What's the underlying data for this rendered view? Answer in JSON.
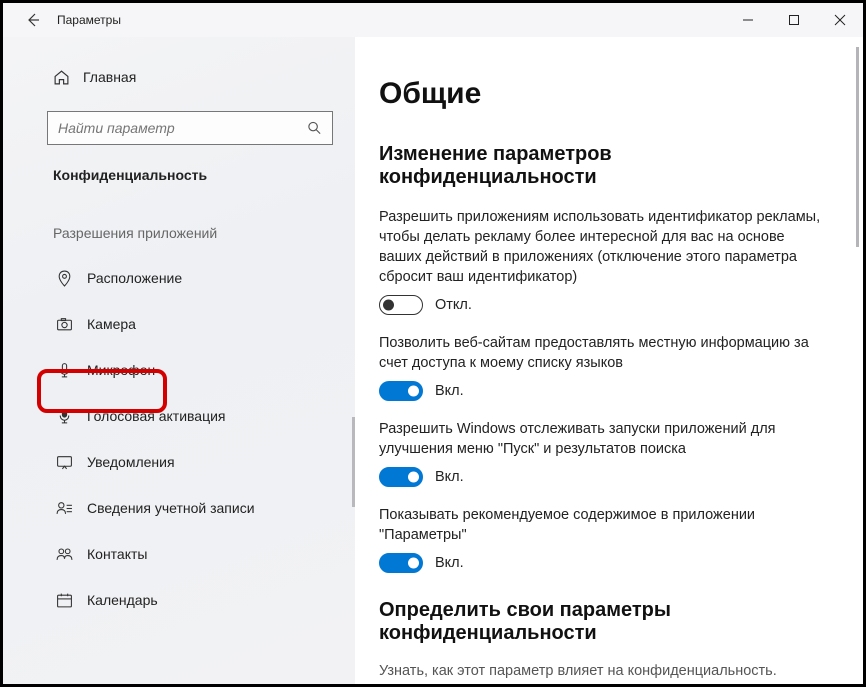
{
  "titlebar": {
    "title": "Параметры"
  },
  "sidebar": {
    "home": "Главная",
    "search_placeholder": "Найти параметр",
    "section": "Конфиденциальность",
    "group": "Разрешения приложений",
    "items": [
      {
        "icon": "location",
        "label": "Расположение"
      },
      {
        "icon": "camera",
        "label": "Камера"
      },
      {
        "icon": "microphone",
        "label": "Микрофон"
      },
      {
        "icon": "voice",
        "label": "Голосовая активация"
      },
      {
        "icon": "notifications",
        "label": "Уведомления"
      },
      {
        "icon": "account",
        "label": "Сведения учетной записи"
      },
      {
        "icon": "contacts",
        "label": "Контакты"
      },
      {
        "icon": "calendar",
        "label": "Календарь"
      }
    ]
  },
  "content": {
    "title": "Общие",
    "section1_title": "Изменение параметров конфиденциальности",
    "settings": [
      {
        "desc": "Разрешить приложениям использовать идентификатор рекламы, чтобы делать рекламу более интересной для вас на основе ваших действий в приложениях (отключение этого параметра сбросит ваш идентификатор)",
        "state": "off",
        "state_label": "Откл."
      },
      {
        "desc": "Позволить веб-сайтам предоставлять местную информацию за счет доступа к моему списку языков",
        "state": "on",
        "state_label": "Вкл."
      },
      {
        "desc": "Разрешить Windows отслеживать запуски приложений для улучшения меню \"Пуск\" и результатов поиска",
        "state": "on",
        "state_label": "Вкл."
      },
      {
        "desc": "Показывать рекомендуемое содержимое в приложении \"Параметры\"",
        "state": "on",
        "state_label": "Вкл."
      }
    ],
    "section2_title": "Определить свои параметры конфиденциальности",
    "footer_hint": "Узнать, как этот параметр влияет на конфиденциальность."
  }
}
